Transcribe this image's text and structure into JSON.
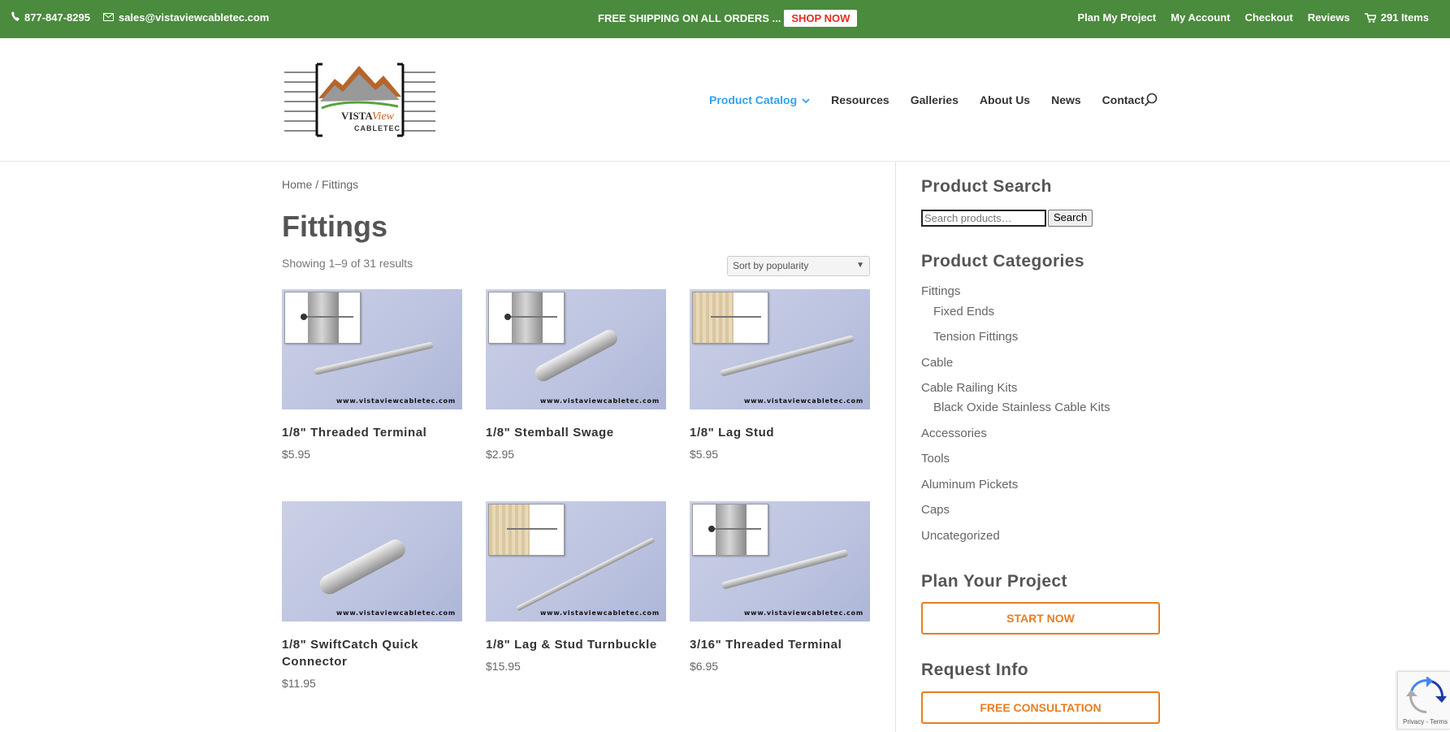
{
  "topbar": {
    "phone": "877-847-8295",
    "email": "sales@vistaviewcabletec.com",
    "promo_text": "FREE SHIPPING ON ALL ORDERS ...",
    "shop_now": "SHOP NOW",
    "links": [
      "Plan My Project",
      "My Account",
      "Checkout",
      "Reviews"
    ],
    "cart": "291 Items",
    "colors": {
      "bar": "#4a8b3d",
      "shop_now_text": "#e52c21"
    }
  },
  "logo": {
    "word_vista": "VISTA",
    "word_view": "View",
    "word_cabletec": "CABLETEC"
  },
  "nav": {
    "items": [
      "Product Catalog",
      "Resources",
      "Galleries",
      "About Us",
      "News",
      "Contact"
    ],
    "active_color": "#2ea3f2"
  },
  "breadcrumb": {
    "home": "Home",
    "separator": " / ",
    "current": "Fittings"
  },
  "page_title": "Fittings",
  "results_text": "Showing 1–9 of 31 results",
  "sort_selected": "Sort by popularity",
  "watermark": "www.vistaviewcabletec.com",
  "products": [
    {
      "name": "1/8\" Threaded Terminal",
      "price": "$5.95",
      "inset": "post",
      "icon": "threaded-terminal"
    },
    {
      "name": "1/8\" Stemball Swage",
      "price": "$2.95",
      "inset": "post",
      "icon": "stemball-swage"
    },
    {
      "name": "1/8\" Lag Stud",
      "price": "$5.95",
      "inset": "wood",
      "icon": "lag-stud"
    },
    {
      "name": "1/8\" SwiftCatch Quick Connector",
      "price": "$11.95",
      "inset": "none",
      "icon": "quick-connector"
    },
    {
      "name": "1/8\" Lag & Stud Turnbuckle",
      "price": "$15.95",
      "inset": "wood",
      "icon": "turnbuckle"
    },
    {
      "name": "3/16\" Threaded Terminal",
      "price": "$6.95",
      "inset": "post",
      "icon": "threaded-terminal"
    }
  ],
  "sidebar": {
    "product_search_title": "Product Search",
    "search_placeholder": "Search products…",
    "search_button": "Search",
    "categories_title": "Product Categories",
    "categories": [
      {
        "label": "Fittings",
        "level": 0
      },
      {
        "label": "Fixed Ends",
        "level": 1
      },
      {
        "label": "Tension Fittings",
        "level": 1
      },
      {
        "label": "Cable",
        "level": 0
      },
      {
        "label": "Cable Railing Kits",
        "level": 0
      },
      {
        "label": "Black Oxide Stainless Cable Kits",
        "level": 1
      },
      {
        "label": "Accessories",
        "level": 0
      },
      {
        "label": "Tools",
        "level": 0
      },
      {
        "label": "Aluminum Pickets",
        "level": 0
      },
      {
        "label": "Caps",
        "level": 0
      },
      {
        "label": "Uncategorized",
        "level": 0
      }
    ],
    "plan_title": "Plan Your Project",
    "plan_button": "START NOW",
    "request_title": "Request Info",
    "request_button": "FREE CONSULTATION",
    "accent_color": "#e67e22"
  },
  "recaptcha": {
    "text": "Privacy - Terms"
  }
}
